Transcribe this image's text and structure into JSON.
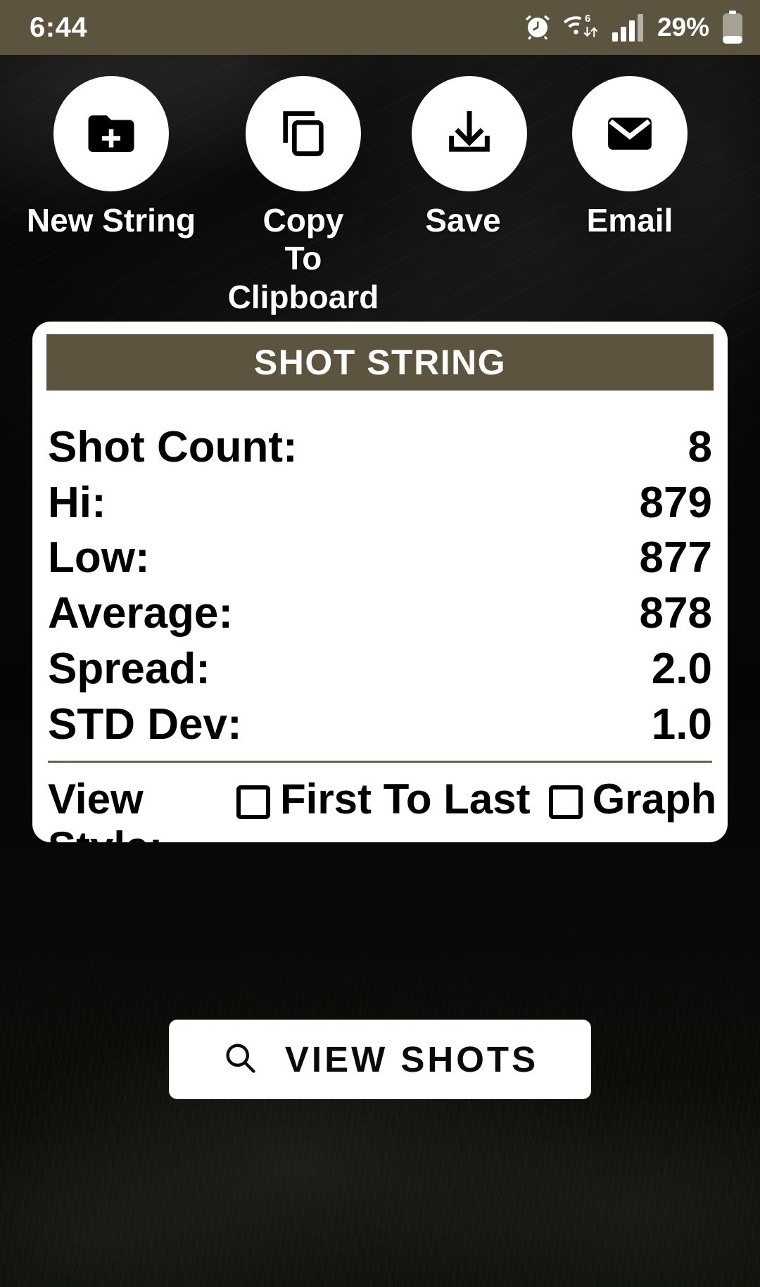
{
  "status_bar": {
    "clock": "6:44",
    "battery_percent": "29%",
    "icons": [
      "alarm-icon",
      "wifi-6-icon",
      "cellular-signal-icon",
      "battery-icon"
    ],
    "background_color": "#5D543F"
  },
  "actions": [
    {
      "id": "new-string",
      "icon": "folder-plus-icon",
      "label": "New String"
    },
    {
      "id": "copy-to-clipboard",
      "icon": "copy-icon",
      "label": "Copy\nTo Clipboard"
    },
    {
      "id": "save",
      "icon": "download-icon",
      "label": "Save"
    },
    {
      "id": "email",
      "icon": "envelope-icon",
      "label": "Email"
    }
  ],
  "card": {
    "title": "SHOT STRING",
    "header_color": "#5D543F",
    "stats": [
      {
        "label": "Shot Count:",
        "value": "8"
      },
      {
        "label": "Hi:",
        "value": "879"
      },
      {
        "label": "Low:",
        "value": "877"
      },
      {
        "label": "Average:",
        "value": "878"
      },
      {
        "label": "Spread:",
        "value": "2.0"
      },
      {
        "label": "STD Dev:",
        "value": "1.0"
      }
    ],
    "view_style": {
      "label": "View\nStyle:",
      "options": [
        {
          "label": "First To Last",
          "checked": false
        },
        {
          "label": "Graph",
          "checked": false
        }
      ]
    }
  },
  "view_shots_button": {
    "icon": "search-icon",
    "label": "VIEW SHOTS"
  }
}
